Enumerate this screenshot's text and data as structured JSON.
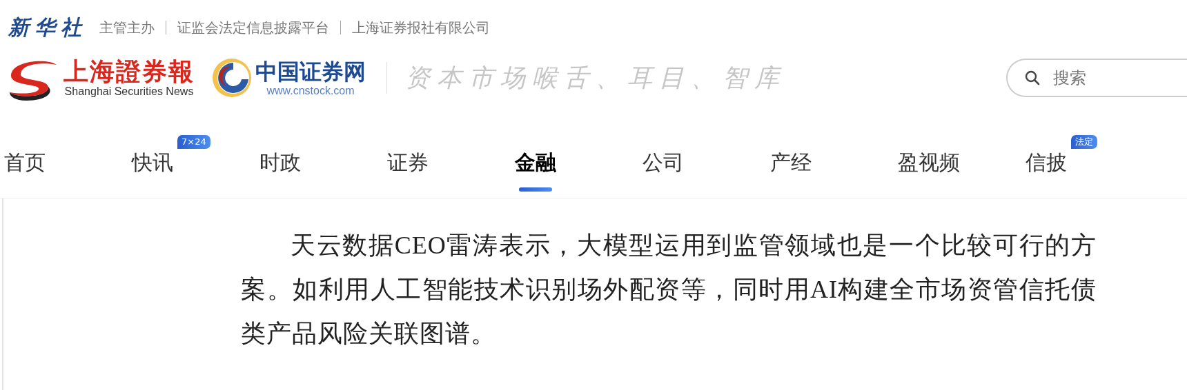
{
  "top_bar": {
    "brand": "新华社",
    "links": [
      "主管主办",
      "证监会法定信息披露平台",
      "上海证券报社有限公司"
    ]
  },
  "header": {
    "logo_1": {
      "name": "上海證券報",
      "subtitle": "Shanghai Securities News"
    },
    "logo_2": {
      "name": "中国证券网",
      "subtitle": "www.cnstock.com"
    },
    "slogan": "资本市场喉舌、耳目、智库",
    "search": {
      "placeholder": "搜索"
    }
  },
  "nav": [
    {
      "label": "首页",
      "selected": false
    },
    {
      "label": "快讯",
      "selected": false,
      "badge": "7×24"
    },
    {
      "label": "时政",
      "selected": false
    },
    {
      "label": "证券",
      "selected": false
    },
    {
      "label": "金融",
      "selected": true
    },
    {
      "label": "公司",
      "selected": false
    },
    {
      "label": "产经",
      "selected": false
    },
    {
      "label": "盈视频",
      "selected": false
    },
    {
      "label": "信披",
      "selected": false,
      "badge": "法定"
    }
  ],
  "article": {
    "paragraphs": [
      "天云数据CEO雷涛表示，大模型运用到监管领域也是一个比较可行的方案。如利用人工智能技术识别场外配资等，同时用AI构建全市场资管信托债类产品风险关联图谱。"
    ]
  }
}
